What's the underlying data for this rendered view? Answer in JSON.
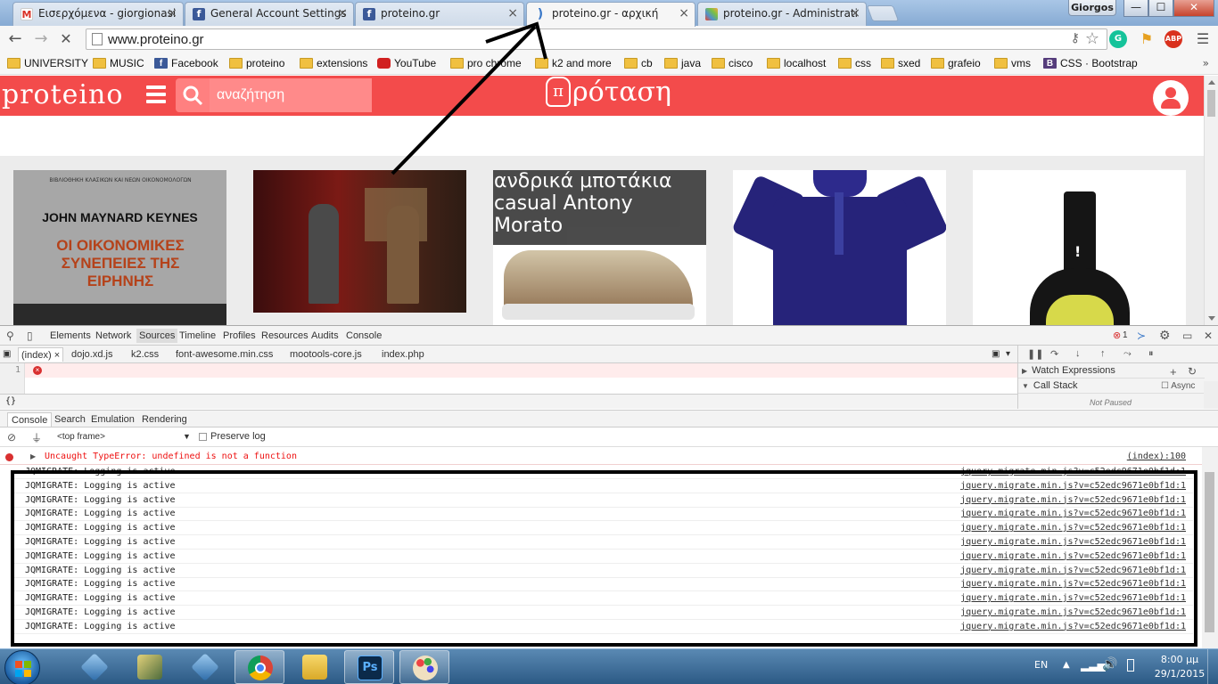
{
  "browser": {
    "tabs": [
      {
        "label": "Εισερχόμενα - giorgionasi",
        "icon": "gmail-icon"
      },
      {
        "label": "General Account Settings",
        "icon": "facebook-icon"
      },
      {
        "label": "proteino.gr",
        "icon": "facebook-icon"
      },
      {
        "label": "proteino.gr - αρχική",
        "icon": "loading-icon",
        "active": true
      },
      {
        "label": "proteino.gr - Administrati",
        "icon": "joomla-icon"
      }
    ],
    "profile_name": "Giorgos",
    "window_buttons": {
      "minimize": "—",
      "maximize": "☐",
      "close": "✕"
    },
    "url": "www.proteino.gr",
    "extensions": [
      "grammarly-icon",
      "bookmark-flag-icon",
      "adblock-plus-icon"
    ],
    "adblock_label": "ABP",
    "bookmarks": [
      {
        "label": "UNIVERSITY",
        "icon": "folder"
      },
      {
        "label": "MUSIC",
        "icon": "folder"
      },
      {
        "label": "Facebook",
        "icon": "facebook"
      },
      {
        "label": "proteino",
        "icon": "folder"
      },
      {
        "label": "extensions",
        "icon": "folder"
      },
      {
        "label": "YouTube",
        "icon": "youtube"
      },
      {
        "label": "pro chrome",
        "icon": "folder"
      },
      {
        "label": "k2 and more",
        "icon": "folder"
      },
      {
        "label": "cb",
        "icon": "folder"
      },
      {
        "label": "java",
        "icon": "folder"
      },
      {
        "label": "cisco",
        "icon": "folder"
      },
      {
        "label": "localhost",
        "icon": "folder"
      },
      {
        "label": "css",
        "icon": "folder"
      },
      {
        "label": "sxed",
        "icon": "folder"
      },
      {
        "label": "grafeio",
        "icon": "folder"
      },
      {
        "label": "vms",
        "icon": "folder"
      },
      {
        "label": "CSS · Bootstrap",
        "icon": "bootstrap"
      }
    ],
    "bookmarks_more": "»"
  },
  "site": {
    "logo": "proteino",
    "search_placeholder": "αναζήτηση",
    "brand_pi": "π",
    "brand_text": "ρόταση",
    "accent_color": "#f34b4b",
    "cards": [
      {
        "type": "book",
        "series": "ΒΙΒΛΙΟΘΗΚΗ ΚΛΑΣΙΚΩΝ ΚΑΙ ΝΕΩΝ ΟΙΚΟΝΟΜΟΛΟΓΩΝ",
        "author": "JOHN MAYNARD KEYNES",
        "title": "ΟΙ ΟΙΚΟΝΟΜΙΚΕΣ ΣΥΝΕΠΕΙΕΣ ΤΗΣ ΕΙΡΗΝΗΣ"
      },
      {
        "type": "theatre-photo"
      },
      {
        "type": "shoes",
        "caption": "ανδρικά μποτάκια casual Antony Morato"
      },
      {
        "type": "polo-shirt"
      },
      {
        "type": "wine-bottle",
        "mark": "!"
      }
    ]
  },
  "devtools": {
    "panels": [
      "Elements",
      "Network",
      "Sources",
      "Timeline",
      "Profiles",
      "Resources",
      "Audits",
      "Console"
    ],
    "selected_panel": "Sources",
    "error_count": "1",
    "files": [
      "(index)",
      "dojo.xd.js",
      "k2.css",
      "font-awesome.min.css",
      "mootools-core.js",
      "index.php"
    ],
    "selected_file": "(index)",
    "file_close": "×",
    "line_number": "1",
    "format_label": "{}",
    "watch_expressions": "Watch Expressions",
    "call_stack": "Call Stack",
    "async_label": "Async",
    "not_paused": "Not Paused",
    "drawer_tabs": [
      "Console",
      "Search",
      "Emulation",
      "Rendering"
    ],
    "selected_drawer": "Console",
    "frame": "<top frame>",
    "preserve_log": "Preserve log",
    "error_message": "Uncaught TypeError: undefined is not a function",
    "error_source": "(index):100",
    "log_message": "JQMIGRATE: Logging is active",
    "log_source": "jquery.migrate.min.js?v=c52edc9671e0bf1d:1",
    "log_count": 12
  },
  "taskbar": {
    "items": [
      "start-orb",
      "virtualbox-icon",
      "sketchup-icon",
      "virtualbox-icon",
      "chrome-icon",
      "file-explorer-icon",
      "photoshop-icon",
      "paint-icon"
    ],
    "photoshop_label": "Ps",
    "language": "EN",
    "time": "8:00 μμ",
    "date": "29/1/2015"
  }
}
